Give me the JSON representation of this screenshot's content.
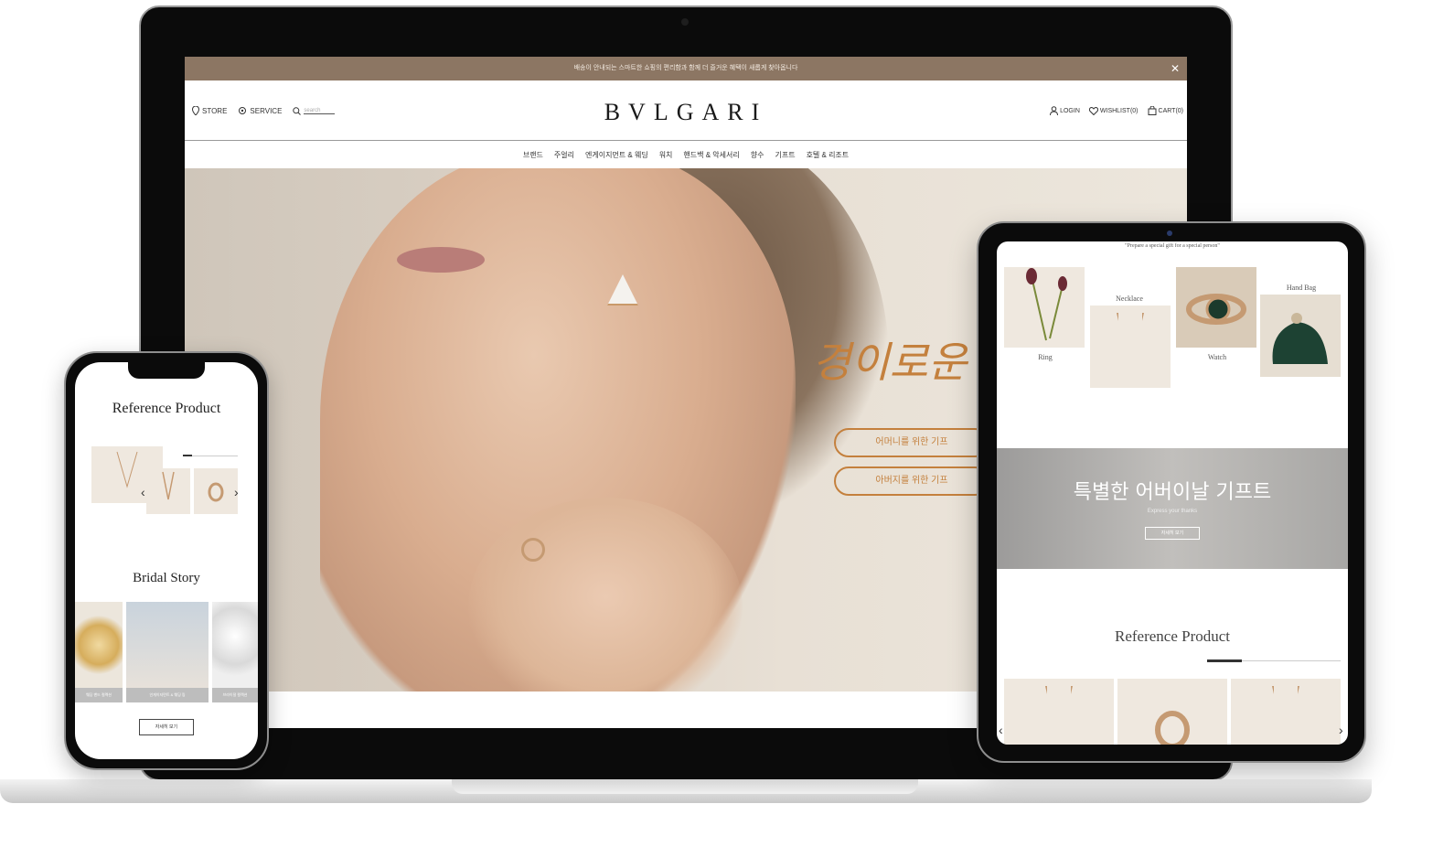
{
  "laptop": {
    "promo_text": "배송이 안내되는 스마트한 쇼핑의 편리함과 함께 더 즐거운 혜택이 새롭게 찾아옵니다",
    "close_glyph": "✕",
    "header": {
      "store": "STORE",
      "service": "SERVICE",
      "search_placeholder": "search",
      "logo": "BVLGARI",
      "login": "LOGIN",
      "wishlist": "WISHLIST(0)",
      "cart": "CART(0)"
    },
    "nav": [
      "브랜드",
      "주얼리",
      "엔게이지먼트 & 웨딩",
      "워치",
      "핸드백 & 악세서리",
      "향수",
      "기프트",
      "호텔 & 리조트"
    ],
    "hero": {
      "title": "경이로운 ",
      "button1": "어머니를 위한 기프",
      "button2": "아버지를 위한 기프"
    }
  },
  "tablet": {
    "top_text": "\"Prepare a special gift for a special person\"",
    "categories": [
      {
        "label": "Ring"
      },
      {
        "label": "Necklace"
      },
      {
        "label": "Watch"
      },
      {
        "label": "Hand Bag"
      }
    ],
    "banner": {
      "title": "특별한 어버이날 기프트",
      "subtitle": "Express your thanks",
      "button": "자세히 보기"
    },
    "reference_title": "Reference Product",
    "arrow_left": "‹",
    "arrow_right": "›"
  },
  "phone": {
    "reference_title": "Reference Product",
    "arrow_left": "‹",
    "arrow_right": "›",
    "story_title": "Bridal Story",
    "stories": [
      {
        "caption": "웨딩 밴드 컬렉션"
      },
      {
        "caption": "인게이지먼트 & 웨딩 링"
      },
      {
        "caption": "브라이덜 컬렉션"
      }
    ],
    "more_button": "자세히 보기"
  },
  "colors": {
    "promo_bar": "#8c7663",
    "accent_orange": "#c4803d",
    "product_bg": "#efe8df"
  }
}
